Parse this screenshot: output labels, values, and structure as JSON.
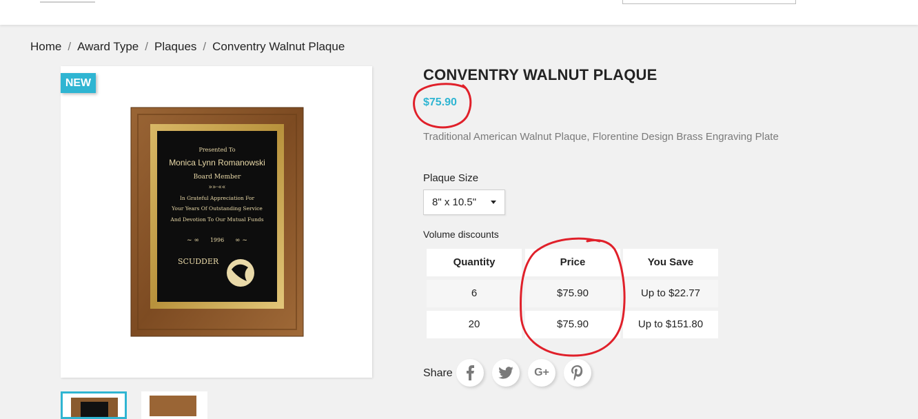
{
  "breadcrumb": [
    "Home",
    "Award Type",
    "Plaques",
    "Conventry Walnut Plaque"
  ],
  "badge": "NEW",
  "product": {
    "title": "CONVENTRY WALNUT PLAQUE",
    "price": "$75.90",
    "description": "Traditional American Walnut Plaque, Florentine Design Brass Engraving Plate",
    "size_label": "Plaque Size",
    "size_value": "8\" x 10.5\""
  },
  "plaque_text": {
    "presented": "Presented To",
    "name": "Monica Lynn Romanowski",
    "role": "Board Member",
    "line1": "In Grateful Appreciation For",
    "line2": "Your Years Of Outstanding Service",
    "line3": "And Devotion To Our Mutual Funds",
    "year": "1996",
    "company": "SCUDDER"
  },
  "volume": {
    "label": "Volume discounts",
    "headers": [
      "Quantity",
      "Price",
      "You Save"
    ],
    "rows": [
      [
        "6",
        "$75.90",
        "Up to $22.77"
      ],
      [
        "20",
        "$75.90",
        "Up to $151.80"
      ]
    ]
  },
  "share": {
    "label": "Share",
    "icons": [
      "facebook-icon",
      "twitter-icon",
      "google-plus-icon",
      "pinterest-icon"
    ]
  },
  "colors": {
    "accent": "#2fb5d2",
    "annotation": "#e0202a"
  }
}
